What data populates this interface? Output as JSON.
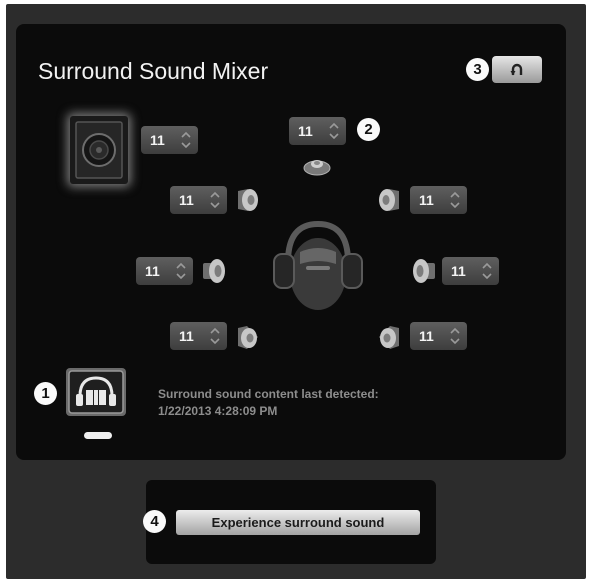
{
  "mixer": {
    "title": "Surround Sound Mixer",
    "channels": [
      {
        "id": "subwoofer",
        "value": "11"
      },
      {
        "id": "center",
        "value": "11"
      },
      {
        "id": "front-left",
        "value": "11"
      },
      {
        "id": "front-right",
        "value": "11"
      },
      {
        "id": "side-left",
        "value": "11"
      },
      {
        "id": "side-right",
        "value": "11"
      },
      {
        "id": "rear-left",
        "value": "11"
      },
      {
        "id": "rear-right",
        "value": "11"
      }
    ],
    "status_label": "Surround sound content last detected:",
    "status_time": "1/22/2013 4:28:09 PM",
    "reset_icon": "undo-arrow-icon"
  },
  "footer": {
    "experience_label": "Experience surround sound"
  },
  "callouts": [
    "1",
    "2",
    "3",
    "4"
  ],
  "colors": {
    "panel": "#0b0b0b",
    "frame": "#2c2c2c",
    "stepper": "#4a4a4a",
    "text": "#f2f2f2",
    "status_text": "#8d8d8d"
  }
}
